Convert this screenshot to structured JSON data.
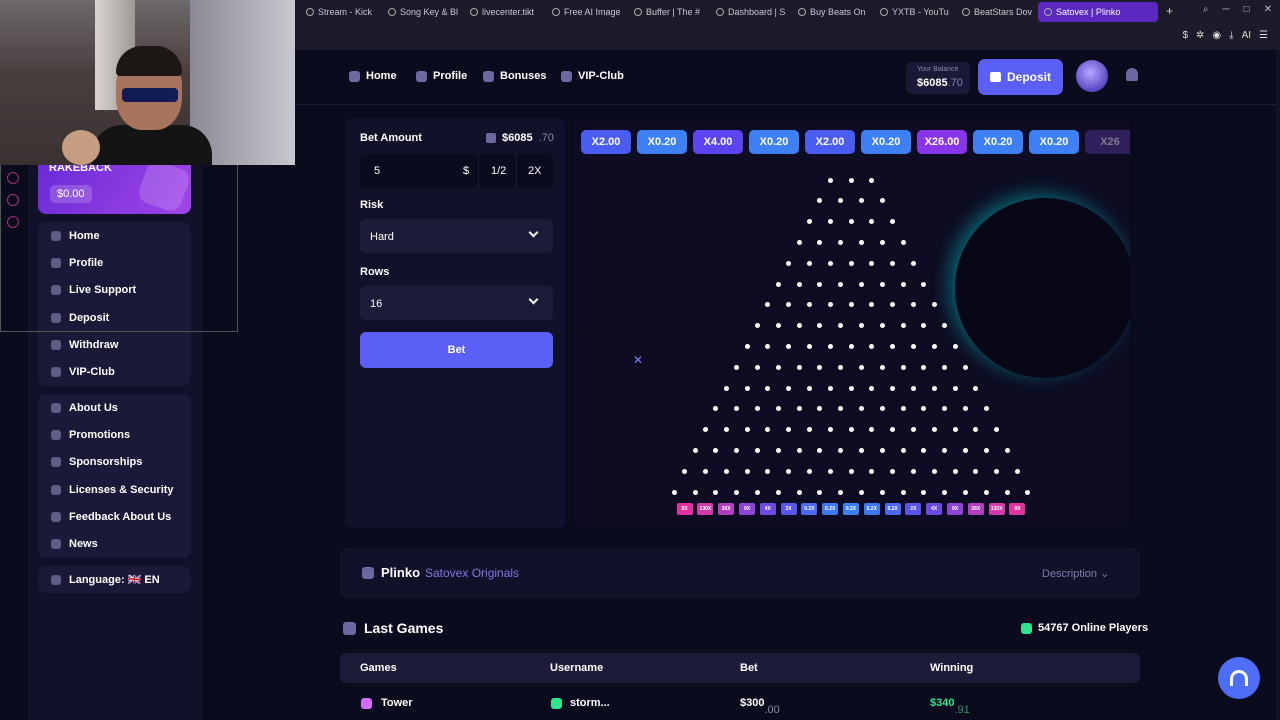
{
  "browser": {
    "tabs": [
      {
        "label": "Stream - Kick",
        "active": false
      },
      {
        "label": "Song Key & Bl",
        "active": false
      },
      {
        "label": "livecenter.tikt",
        "active": false
      },
      {
        "label": "Free AI Image",
        "active": false
      },
      {
        "label": "Buffer | The #",
        "active": false
      },
      {
        "label": "Dashboard | S",
        "active": false
      },
      {
        "label": "Buy Beats On",
        "active": false
      },
      {
        "label": "YXTB - YouTu",
        "active": false
      },
      {
        "label": "BeatStars Dov",
        "active": false
      },
      {
        "label": "Satovex | Plinko",
        "active": true
      }
    ],
    "new_tab": "+",
    "toolbar_ai": "AI"
  },
  "sidebar": {
    "rakeback_title": "RAKEBACK",
    "rakeback_value": "$0.00",
    "group1": [
      "Home",
      "Profile",
      "Live Support",
      "Deposit",
      "Withdraw",
      "VIP-Club"
    ],
    "group2": [
      "About Us",
      "Promotions",
      "Sponsorships",
      "Licenses & Security",
      "Feedback About Us",
      "News"
    ],
    "language": "Language: 🇬🇧 EN"
  },
  "header": {
    "nav": [
      "Home",
      "Profile",
      "Bonuses",
      "VIP-Club"
    ],
    "balance_label": "Your Balance",
    "balance_main": "$6085",
    "balance_dec": ".70",
    "deposit_label": "Deposit"
  },
  "controls": {
    "bet_amount_label": "Bet Amount",
    "balance_main": "$6085",
    "balance_dec": ".70",
    "bet_value": "5",
    "currency": "$",
    "half": "1/2",
    "double": "2X",
    "risk_label": "Risk",
    "risk_value": "Hard",
    "rows_label": "Rows",
    "rows_value": "16",
    "bet_button": "Bet"
  },
  "history": [
    "X2.00",
    "X0.20",
    "X4.00",
    "X0.20",
    "X2.00",
    "X0.20",
    "X26.00",
    "X0.20",
    "X0.20",
    "X26"
  ],
  "multipliers": [
    "9X",
    "130X",
    "26X",
    "9X",
    "4X",
    "2X",
    "0.2X",
    "0.2X",
    "0.2X",
    "0.2X",
    "0.2X",
    "2X",
    "4X",
    "9X",
    "26X",
    "130X",
    "9X"
  ],
  "colors": {
    "accent": "#5b5ff5",
    "green": "#2ee58d",
    "purple": "#a145e8",
    "pink": "#e0339f",
    "blue": "#4f6ef7"
  },
  "game_bar": {
    "title": "Plinko",
    "subtitle": "Satovex Originals",
    "description": "Description"
  },
  "last_games": {
    "title": "Last Games",
    "online": "54767 Online Players",
    "columns": [
      "Games",
      "Username",
      "Bet",
      "Winning"
    ],
    "rows": [
      {
        "game": "Tower",
        "user": "storm...",
        "bet_main": "$300",
        "bet_dec": ".00",
        "win_main": "$340",
        "win_dec": ".91"
      }
    ]
  }
}
